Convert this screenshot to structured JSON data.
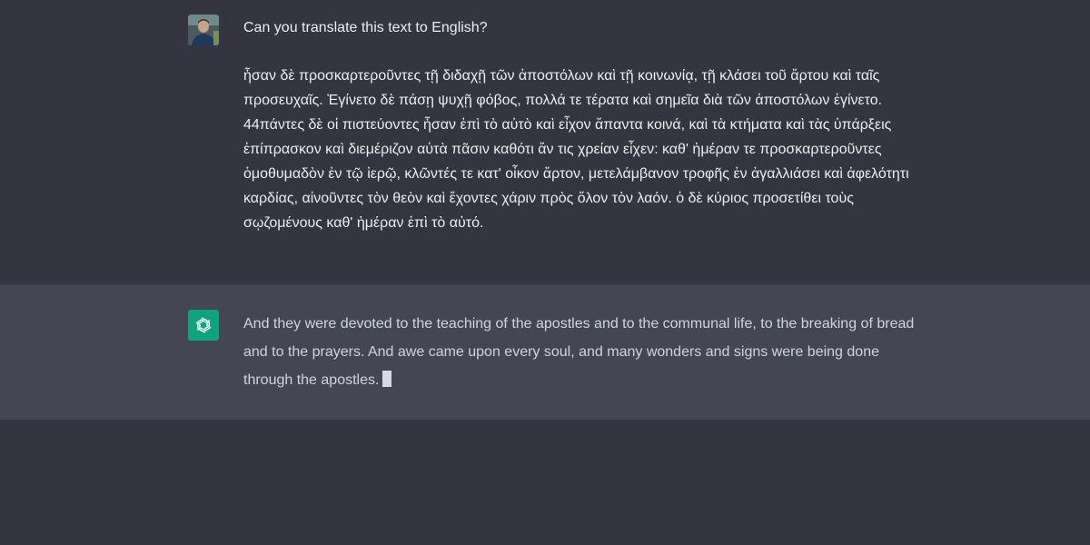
{
  "conversation": {
    "user": {
      "avatar_icon": "user-photo-avatar",
      "question": "Can you translate this text to English?",
      "greek_text": "ἦσαν δὲ προσκαρτεροῦντες τῇ διδαχῇ τῶν ἀποστόλων καὶ τῇ κοινωνίᾳ, τῇ κλάσει τοῦ ἄρτου καὶ ταῖς προσευχαῖς. Ἐγίνετο δὲ πάσῃ ψυχῇ φόβος, πολλά τε τέρατα καὶ σημεῖα διὰ τῶν ἀποστόλων ἐγίνετο. 44πάντες δὲ οἱ πιστεύοντες ἦσαν ἐπὶ τὸ αὐτὸ καὶ εἶχον ἅπαντα κοινά, καὶ τὰ κτήματα καὶ τὰς ὑπάρξεις ἐπίπρασκον καὶ διεμέριζον αὐτὰ πᾶσιν καθότι ἄν τις χρείαν εἶχεν: καθ' ἡμέραν τε προσκαρτεροῦντες ὁμοθυμαδὸν ἐν τῷ ἱερῷ, κλῶντές τε κατ' οἶκον ἄρτον, μετελάμβανον τροφῆς ἐν ἀγαλλιάσει καὶ ἀφελότητι καρδίας, αἰνοῦντες τὸν θεὸν καὶ ἔχοντες χάριν πρὸς ὅλον τὸν λαόν. ὁ δὲ κύριος προσετίθει τοὺς σῳζομένους καθ' ἡμέραν ἐπὶ τὸ αὐτό."
    },
    "assistant": {
      "avatar_icon": "openai-logo-icon",
      "avatar_color": "#10a37f",
      "response": "And they were devoted to the teaching of the apostles and to the communal life, to the breaking of bread and to the prayers. And awe came upon every soul, and many wonders and signs were being done through the apostles."
    }
  },
  "colors": {
    "background": "#343541",
    "assistant_background": "#444654",
    "text": "#ececf1"
  }
}
